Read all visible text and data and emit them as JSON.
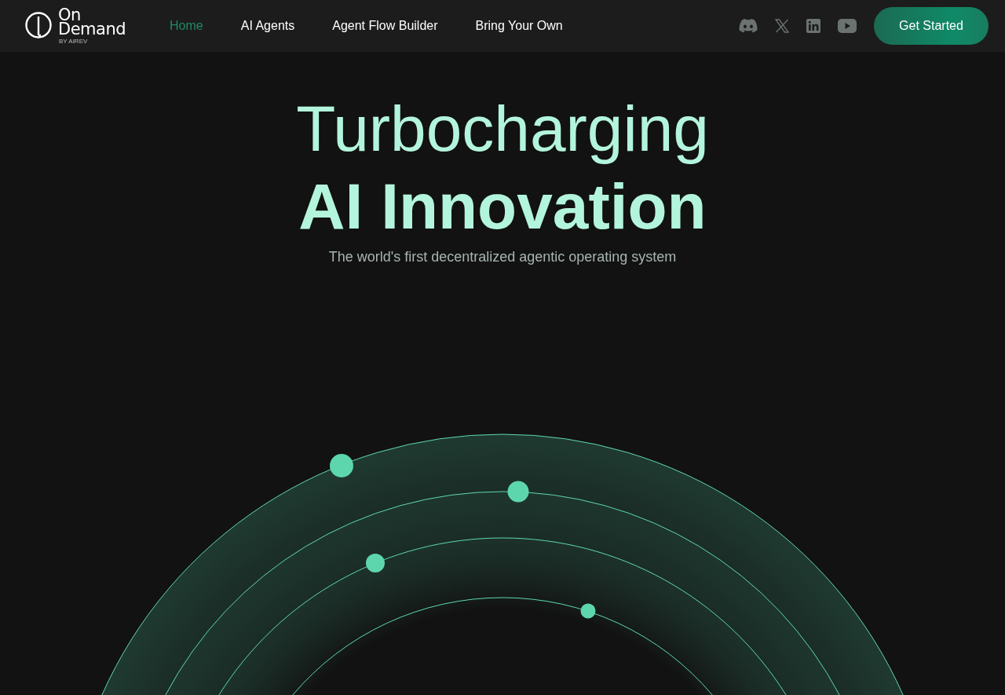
{
  "brand": {
    "name_line_1": "On",
    "name_line_2": "Demand",
    "byline": "BY AIREV"
  },
  "nav": [
    {
      "label": "Home",
      "selected": true
    },
    {
      "label": "AI Agents",
      "selected": false
    },
    {
      "label": "Agent Flow Builder",
      "selected": false
    },
    {
      "label": "Bring Your Own",
      "selected": false
    }
  ],
  "cta": "Get Started",
  "hero": {
    "title_line_1": "Turbocharging",
    "title_line_2": "AI Innovation",
    "subtitle": "The world's first decentralized agentic operating system"
  }
}
